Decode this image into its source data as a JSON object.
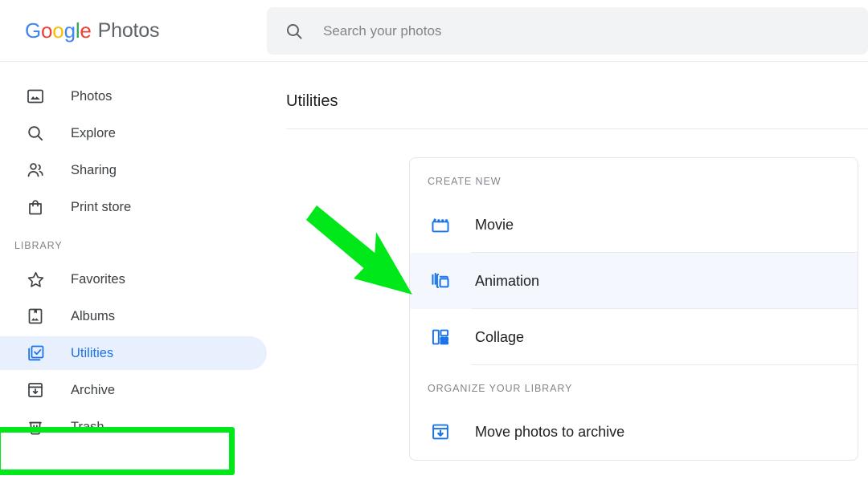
{
  "app": {
    "brand_google": "Google",
    "brand_product": "Photos"
  },
  "search": {
    "placeholder": "Search your photos",
    "value": "",
    "icon": "search-icon"
  },
  "sidebar": {
    "primary_items": [
      {
        "label": "Photos",
        "icon": "photo-icon"
      },
      {
        "label": "Explore",
        "icon": "search-icon"
      },
      {
        "label": "Sharing",
        "icon": "people-icon"
      },
      {
        "label": "Print store",
        "icon": "shopping-bag-icon"
      }
    ],
    "library_section_label": "LIBRARY",
    "library_items": [
      {
        "label": "Favorites",
        "icon": "star-icon",
        "active": false
      },
      {
        "label": "Albums",
        "icon": "album-icon",
        "active": false
      },
      {
        "label": "Utilities",
        "icon": "utilities-icon",
        "active": true
      },
      {
        "label": "Archive",
        "icon": "archive-icon",
        "active": false
      },
      {
        "label": "Trash",
        "icon": "trash-icon",
        "active": false
      }
    ]
  },
  "main": {
    "page_title": "Utilities",
    "card": {
      "create_new_label": "CREATE NEW",
      "create_new_items": [
        {
          "label": "Movie",
          "icon": "movie-clapperboard-icon",
          "highlight": false
        },
        {
          "label": "Animation",
          "icon": "animation-frames-icon",
          "highlight": true
        },
        {
          "label": "Collage",
          "icon": "collage-grid-icon",
          "highlight": false
        }
      ],
      "organize_label": "ORGANIZE YOUR LIBRARY",
      "organize_items": [
        {
          "label": "Move photos to archive",
          "icon": "archive-down-icon",
          "highlight": false
        }
      ]
    }
  },
  "annotations": {
    "arrow_color": "#00e81a",
    "highlight_box_color": "#00e81a",
    "arrow_target": "Animation",
    "highlight_box_target": "Utilities"
  },
  "colors": {
    "accent_blue": "#1a73e8",
    "active_bg": "#e8f0fe",
    "row_highlight_bg": "#f4f8fe",
    "text_primary": "#202124",
    "text_secondary": "#5f6368",
    "text_muted": "#80868b",
    "search_bg": "#f1f3f4",
    "border": "#e8eaed",
    "google_blue": "#4285F4",
    "google_red": "#EA4335",
    "google_yellow": "#FBBC05",
    "google_green": "#34A853"
  }
}
